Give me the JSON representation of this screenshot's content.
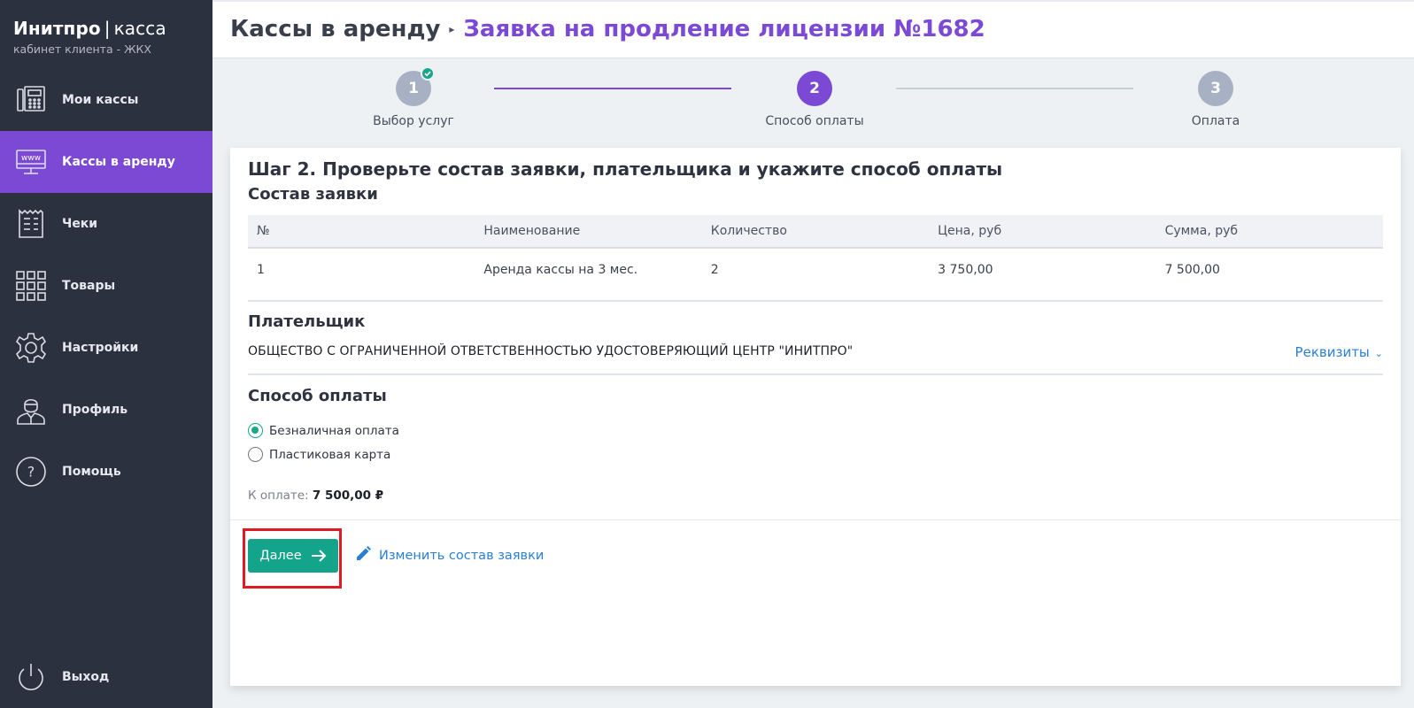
{
  "brand": {
    "name": "Инитпро",
    "separator": "|",
    "product": "касса",
    "subtitle": "кабинет клиента - ЖКХ"
  },
  "sidebar": {
    "items": [
      {
        "label": "Мои кассы",
        "icon": "cash-register-icon"
      },
      {
        "label": "Кассы в аренду",
        "icon": "www-monitor-icon",
        "active": true
      },
      {
        "label": "Чеки",
        "icon": "receipt-icon"
      },
      {
        "label": "Товары",
        "icon": "grid-icon"
      },
      {
        "label": "Настройки",
        "icon": "gear-icon"
      },
      {
        "label": "Профиль",
        "icon": "user-icon"
      },
      {
        "label": "Помощь",
        "icon": "help-icon"
      }
    ],
    "logout_label": "Выход",
    "logout_icon": "power-icon"
  },
  "header": {
    "root": "Кассы в аренду",
    "current": "Заявка на продление лицензии №1682"
  },
  "stepper": {
    "steps": [
      {
        "number": "1",
        "label": "Выбор услуг",
        "state": "done"
      },
      {
        "number": "2",
        "label": "Способ оплаты",
        "state": "active"
      },
      {
        "number": "3",
        "label": "Оплата",
        "state": "pending"
      }
    ]
  },
  "card": {
    "title": "Шаг 2. Проверьте состав заявки, плательщика и укажите способ оплаты",
    "order_title": "Состав заявки",
    "table": {
      "headers": [
        "№",
        "Наименование",
        "Количество",
        "Цена, руб",
        "Сумма, руб"
      ],
      "rows": [
        [
          "1",
          "Аренда кассы на 3 мес.",
          "2",
          "3 750,00",
          "7 500,00"
        ]
      ]
    },
    "payer_title": "Плательщик",
    "payer_name": "ОБЩЕСТВО С ОГРАНИЧЕННОЙ ОТВЕТСТВЕННОСТЬЮ УДОСТОВЕРЯЮЩИЙ ЦЕНТР \"ИНИТПРО\"",
    "requisites_label": "Реквизиты",
    "payment_title": "Способ оплаты",
    "payment_options": [
      {
        "label": "Безналичная оплата",
        "checked": true
      },
      {
        "label": "Пластиковая карта",
        "checked": false
      }
    ],
    "total_label": "К оплате:",
    "total_value": "7 500,00 ₽",
    "next_label": "Далее",
    "edit_label": "Изменить состав заявки"
  },
  "colors": {
    "sidebar_bg": "#2c3140",
    "accent_purple": "#7b49d4",
    "accent_green": "#14a38b",
    "link_blue": "#2a7fd4",
    "highlight_red": "#e01a24"
  }
}
